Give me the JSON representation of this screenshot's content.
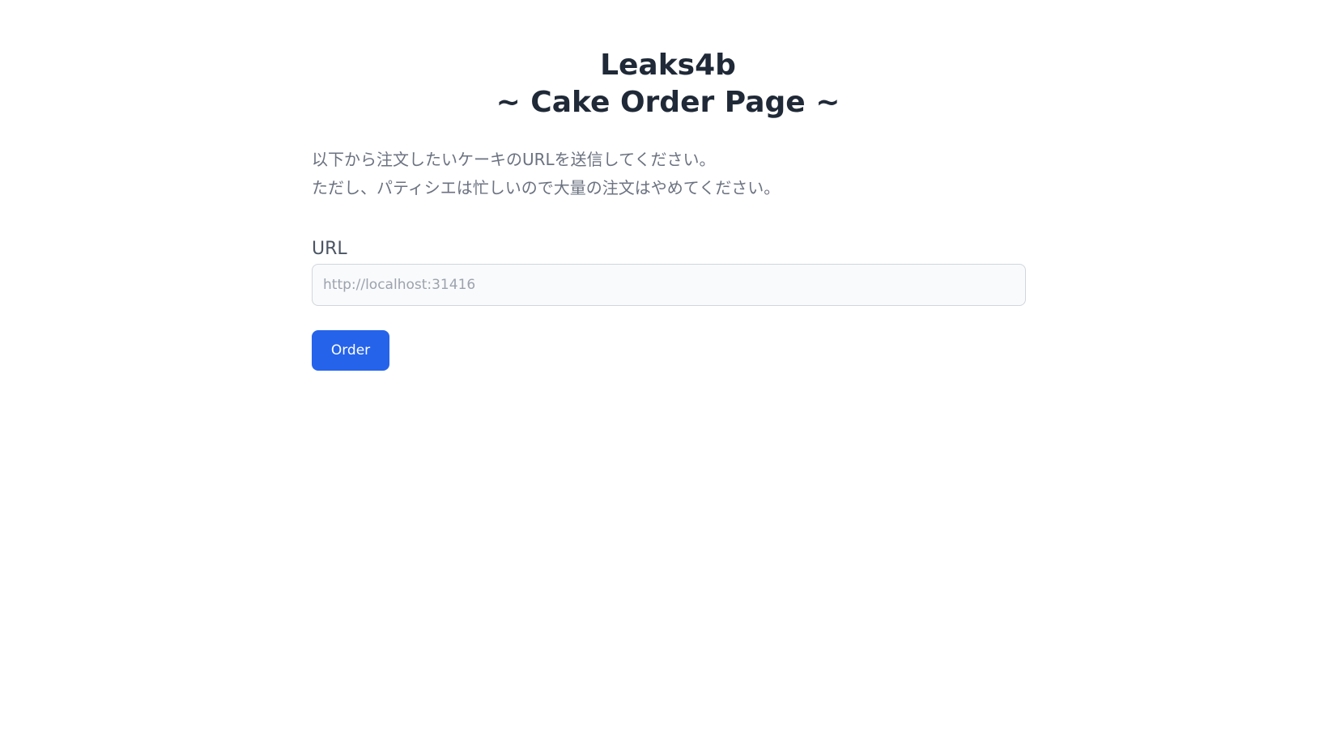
{
  "header": {
    "title_line1": "Leaks4b",
    "title_line2": "~ Cake Order Page ~"
  },
  "description": {
    "line1": "以下から注文したいケーキのURLを送信してください。",
    "line2": "ただし、パティシエは忙しいので大量の注文はやめてください。"
  },
  "form": {
    "url_label": "URL",
    "url_value": "",
    "url_placeholder": "http://localhost:31416",
    "order_label": "Order"
  },
  "colors": {
    "accent": "#2563eb",
    "heading": "#1f2937",
    "muted_text": "#6b7280"
  }
}
